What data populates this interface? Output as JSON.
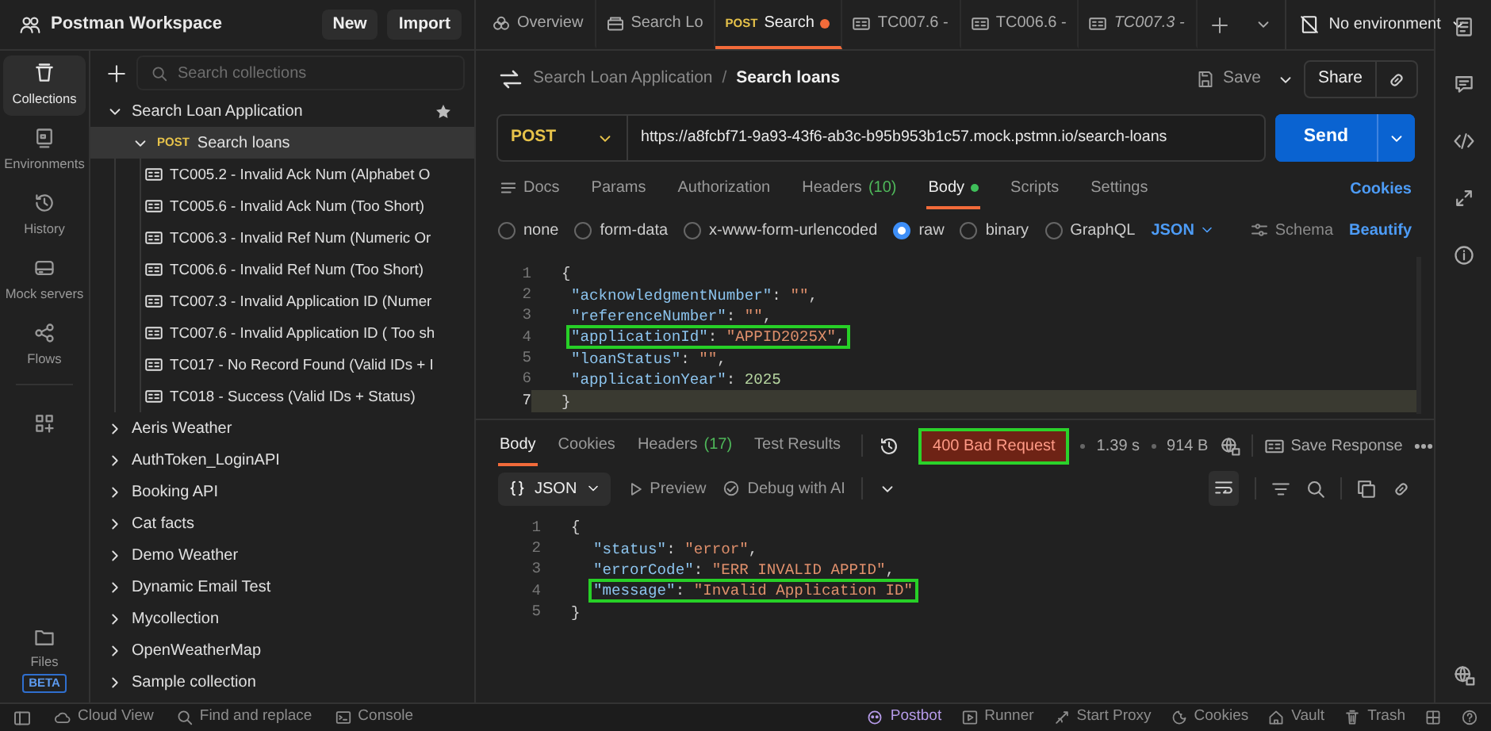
{
  "workspace": {
    "title": "Postman Workspace",
    "buttons": [
      "New",
      "Import"
    ]
  },
  "rail": [
    {
      "kind": "collections",
      "label": "Collections",
      "selected": true
    },
    {
      "kind": "environments",
      "label": "Environments",
      "selected": false
    },
    {
      "kind": "history",
      "label": "History",
      "selected": false
    },
    {
      "kind": "mock",
      "label": "Mock servers",
      "selected": false
    },
    {
      "kind": "flows",
      "label": "Flows",
      "selected": false
    },
    {
      "kind": "apps",
      "selected": false
    }
  ],
  "files": {
    "label": "Files",
    "badge": "BETA"
  },
  "sidebar": {
    "search": {
      "placeholder": "Search collections"
    },
    "tree": [
      {
        "kind": "collection",
        "label": "Search Loan Application",
        "expanded": true,
        "starred": true,
        "selected": false,
        "children": [
          {
            "kind": "request",
            "method": "POST",
            "label": "Search loans",
            "expanded": true,
            "selected": true,
            "children": [
              {
                "kind": "example",
                "label": "TC005.2 - Invalid Ack Num (Alphabet O",
                "selected": false
              },
              {
                "kind": "example",
                "label": "TC005.6 - Invalid Ack Num (Too Short)",
                "selected": false
              },
              {
                "kind": "example",
                "label": "TC006.3 - Invalid Ref Num (Numeric Or",
                "selected": false
              },
              {
                "kind": "example",
                "label": "TC006.6 - Invalid Ref Num (Too Short)",
                "selected": false
              },
              {
                "kind": "example",
                "label": "TC007.3 - Invalid Application ID (Numer",
                "selected": false
              },
              {
                "kind": "example",
                "label": "TC007.6 - Invalid Application ID ( Too sh",
                "selected": false
              },
              {
                "kind": "example",
                "label": "TC017 - No Record Found (Valid IDs + I",
                "selected": false
              },
              {
                "kind": "example",
                "label": "TC018 - Success (Valid IDs + Status)",
                "selected": false
              }
            ]
          }
        ]
      },
      {
        "kind": "collection",
        "label": "Aeris Weather",
        "expanded": false,
        "starred": false,
        "selected": false
      },
      {
        "kind": "collection",
        "label": "AuthToken_LoginAPI",
        "expanded": false,
        "starred": false,
        "selected": false
      },
      {
        "kind": "collection",
        "label": "Booking API",
        "expanded": false,
        "starred": false,
        "selected": false
      },
      {
        "kind": "collection",
        "label": "Cat facts",
        "expanded": false,
        "starred": false,
        "selected": false
      },
      {
        "kind": "collection",
        "label": "Demo Weather",
        "expanded": false,
        "starred": false,
        "selected": false
      },
      {
        "kind": "collection",
        "label": "Dynamic Email Test",
        "expanded": false,
        "starred": false,
        "selected": false
      },
      {
        "kind": "collection",
        "label": "Mycollection",
        "expanded": false,
        "starred": false,
        "selected": false
      },
      {
        "kind": "collection",
        "label": "OpenWeatherMap",
        "expanded": false,
        "starred": false,
        "selected": false
      },
      {
        "kind": "collection",
        "label": "Sample collection",
        "expanded": false,
        "starred": false,
        "selected": false
      }
    ]
  },
  "tabs": [
    {
      "kind": "overview",
      "label": "Overview",
      "selected": false
    },
    {
      "kind": "collection",
      "label": "Search Lo",
      "selected": false
    },
    {
      "kind": "request",
      "method": "POST",
      "label": "Search",
      "selected": true,
      "unsaved": true
    },
    {
      "kind": "example",
      "label": "TC007.6 -",
      "selected": false
    },
    {
      "kind": "example",
      "label": "TC006.6 -",
      "selected": false
    },
    {
      "kind": "example",
      "label": "TC007.3 -",
      "selected": false,
      "preview": true
    }
  ],
  "environment": "No environment",
  "breadcrumb": {
    "parent": "Search Loan Application",
    "separator": "/",
    "title": "Search loans"
  },
  "request_actions": {
    "save": "Save",
    "share": "Share"
  },
  "url_bar": {
    "method": "POST",
    "url": "https://a8fcbf71-9a93-43f6-ab3c-b95b953b1c57.mock.pstmn.io/search-loans",
    "send": "Send"
  },
  "request_tabs": [
    {
      "kind": "docs",
      "label": "Docs",
      "selected": false
    },
    {
      "label": "Params",
      "selected": false
    },
    {
      "label": "Authorization",
      "selected": false
    },
    {
      "label": "Headers",
      "count": "(10)",
      "selected": false
    },
    {
      "label": "Body",
      "dot": true,
      "selected": true
    },
    {
      "label": "Scripts",
      "selected": false
    },
    {
      "label": "Settings",
      "selected": false
    }
  ],
  "cookies_link": "Cookies",
  "body_types": [
    {
      "label": "none",
      "selected": false
    },
    {
      "label": "form-data",
      "selected": false
    },
    {
      "label": "x-www-form-urlencoded",
      "selected": false
    },
    {
      "label": "raw",
      "selected": true
    },
    {
      "label": "binary",
      "selected": false
    },
    {
      "label": "GraphQL",
      "selected": false
    }
  ],
  "body_format": "JSON",
  "body_actions": {
    "schema": "Schema",
    "beautify": "Beautify"
  },
  "request_body": [
    {
      "number": "1",
      "highlighted": false,
      "current": false,
      "tokens": [
        {
          "kind": "punct",
          "text": "{"
        }
      ],
      "children": [
        {
          "number": "2",
          "highlighted": false,
          "current": false,
          "tokens": [
            {
              "kind": "key",
              "text": "\"acknowledgmentNumber\""
            },
            {
              "kind": "punct",
              "text": ": "
            },
            {
              "kind": "string",
              "text": "\"\""
            },
            {
              "kind": "punct",
              "text": ","
            }
          ]
        },
        {
          "number": "3",
          "highlighted": false,
          "current": false,
          "tokens": [
            {
              "kind": "key",
              "text": "\"referenceNumber\""
            },
            {
              "kind": "punct",
              "text": ": "
            },
            {
              "kind": "string",
              "text": "\"\""
            },
            {
              "kind": "punct",
              "text": ","
            }
          ]
        },
        {
          "number": "4",
          "highlighted": true,
          "current": false,
          "tokens": [
            {
              "kind": "key",
              "text": "\"applicationId\""
            },
            {
              "kind": "punct",
              "text": ": "
            },
            {
              "kind": "string",
              "text": "\"APPID2025X\""
            },
            {
              "kind": "punct",
              "text": ","
            }
          ]
        },
        {
          "number": "5",
          "highlighted": false,
          "current": false,
          "tokens": [
            {
              "kind": "key",
              "text": "\"loanStatus\""
            },
            {
              "kind": "punct",
              "text": ": "
            },
            {
              "kind": "string",
              "text": "\"\""
            },
            {
              "kind": "punct",
              "text": ","
            }
          ]
        },
        {
          "number": "6",
          "highlighted": false,
          "current": false,
          "tokens": [
            {
              "kind": "key",
              "text": "\"applicationYear\""
            },
            {
              "kind": "punct",
              "text": ": "
            },
            {
              "kind": "number",
              "text": "2025"
            }
          ]
        }
      ]
    },
    {
      "number": "7",
      "highlighted": false,
      "current": true,
      "tokens": [
        {
          "kind": "punct",
          "text": "}"
        }
      ]
    }
  ],
  "response_tabs": [
    {
      "label": "Body",
      "selected": true
    },
    {
      "label": "Cookies",
      "selected": false
    },
    {
      "label": "Headers",
      "count": "(17)",
      "selected": false
    },
    {
      "label": "Test Results",
      "selected": false
    }
  ],
  "response_meta": {
    "status": "400 Bad Request",
    "status_highlighted": true,
    "time": "1.39 s",
    "size": "914 B",
    "save": "Save Response"
  },
  "response_toolbar": {
    "format": "JSON",
    "preview": "Preview",
    "debug": "Debug with AI"
  },
  "response_body": [
    {
      "number": "1",
      "highlighted": false,
      "tokens": [
        {
          "kind": "punct",
          "text": "{"
        }
      ],
      "children": [
        {
          "number": "2",
          "highlighted": false,
          "tokens": [
            {
              "kind": "key",
              "text": "\"status\""
            },
            {
              "kind": "punct",
              "text": ": "
            },
            {
              "kind": "string",
              "text": "\"error\""
            },
            {
              "kind": "punct",
              "text": ","
            }
          ]
        },
        {
          "number": "3",
          "highlighted": false,
          "tokens": [
            {
              "kind": "key",
              "text": "\"errorCode\""
            },
            {
              "kind": "punct",
              "text": ": "
            },
            {
              "kind": "string",
              "text": "\"ERR INVALID APPID\""
            },
            {
              "kind": "punct",
              "text": ","
            }
          ]
        },
        {
          "number": "4",
          "highlighted": true,
          "tokens": [
            {
              "kind": "key",
              "text": "\"message\""
            },
            {
              "kind": "punct",
              "text": ": "
            },
            {
              "kind": "string",
              "text": "\"Invalid Application ID\""
            }
          ]
        }
      ]
    },
    {
      "number": "5",
      "highlighted": false,
      "tokens": [
        {
          "kind": "punct",
          "text": "}"
        }
      ]
    }
  ],
  "status_bar": {
    "left": [
      {
        "kind": "cloud",
        "label": "Cloud View"
      },
      {
        "kind": "search",
        "label": "Find and replace"
      },
      {
        "kind": "console",
        "label": "Console"
      }
    ],
    "right": [
      {
        "kind": "postbot",
        "label": "Postbot"
      },
      {
        "kind": "runner",
        "label": "Runner"
      },
      {
        "kind": "proxy",
        "label": "Start Proxy"
      },
      {
        "kind": "cookie",
        "label": "Cookies"
      },
      {
        "kind": "vault",
        "label": "Vault"
      },
      {
        "kind": "trash",
        "label": "Trash"
      }
    ]
  }
}
